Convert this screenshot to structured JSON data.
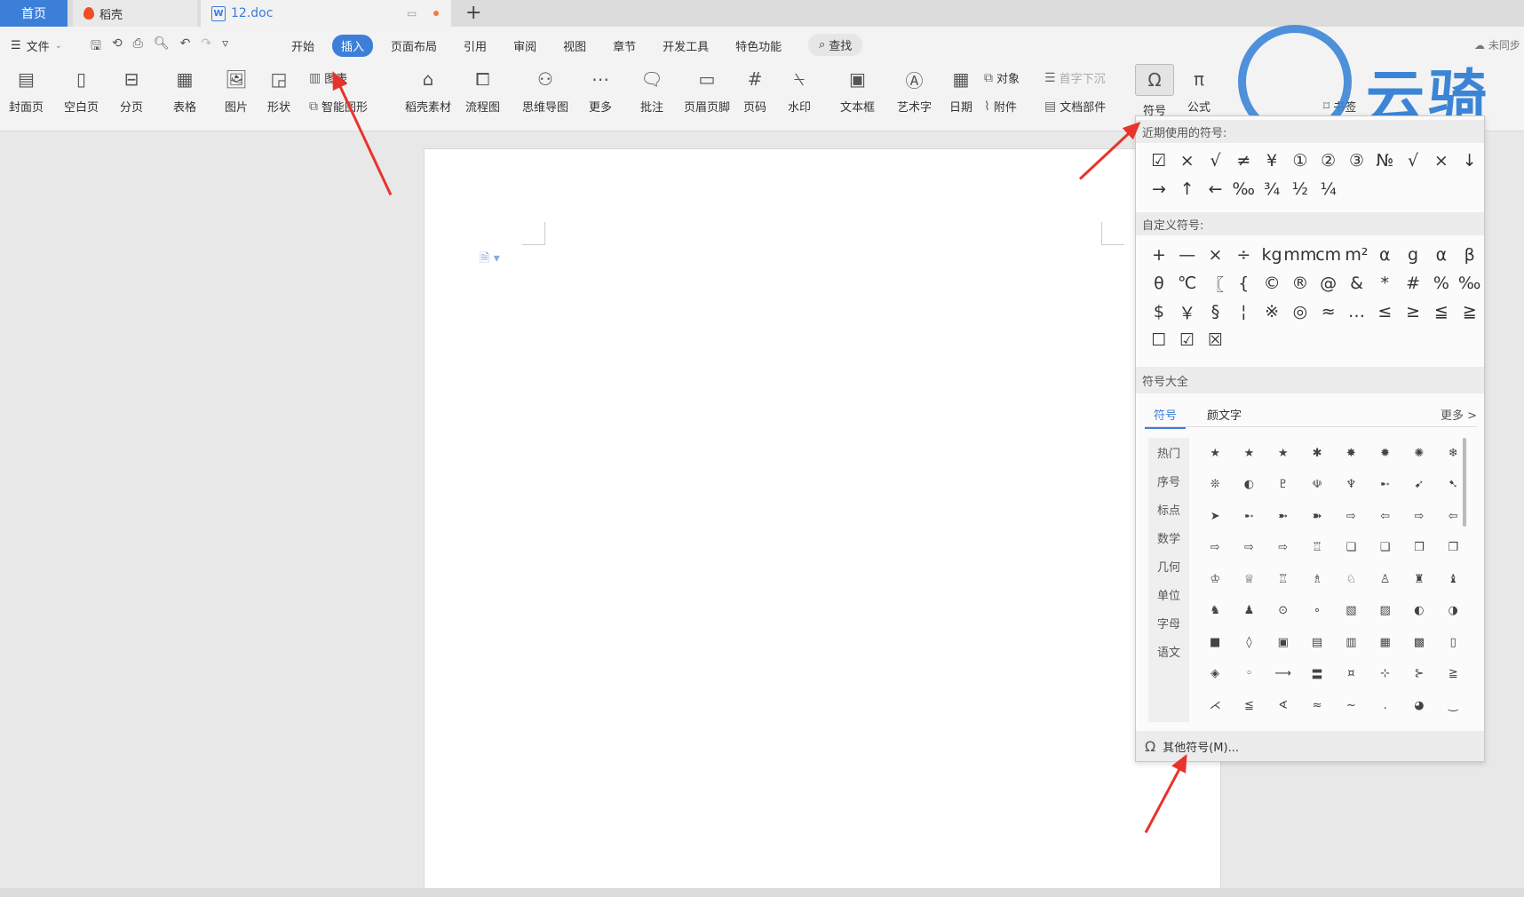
{
  "tabbar": {
    "home": "首页",
    "daoke": "稻壳",
    "doc": "12.doc",
    "plus": "+"
  },
  "menu": {
    "file": "文件",
    "items": [
      "开始",
      "插入",
      "页面布局",
      "引用",
      "审阅",
      "视图",
      "章节",
      "开发工具",
      "特色功能"
    ],
    "active": "插入",
    "search": "查找",
    "sync": "未同步"
  },
  "ribbon": {
    "buttons": [
      "封面页",
      "空白页",
      "分页",
      "表格",
      "图片",
      "形状",
      "稻壳素材",
      "流程图",
      "思维导图",
      "更多",
      "批注",
      "页眉页脚",
      "页码",
      "水印",
      "文本框",
      "艺术字",
      "日期",
      "符号",
      "公式"
    ],
    "small": {
      "chart": "图表",
      "smart_shape": "智能图形",
      "object": "对象",
      "drop_cap": "首字下沉",
      "attachment": "附件",
      "doc_parts": "文档部件",
      "bookmark": "书签"
    }
  },
  "logo": {
    "text": "云骑"
  },
  "symbol_panel": {
    "recent_header": "近期使用的符号:",
    "recent": [
      "☑",
      "×",
      "√",
      "≠",
      "¥",
      "①",
      "②",
      "③",
      "№",
      "√",
      "×",
      "↓",
      "→",
      "↑",
      "←",
      "‰",
      "¾",
      "½",
      "¼"
    ],
    "custom_header": "自定义符号:",
    "custom": [
      "+",
      "—",
      "×",
      "÷",
      "kg",
      "mm",
      "cm",
      "m²",
      "α",
      "g",
      "α",
      "β",
      "θ",
      "℃",
      "〖",
      "{",
      "©",
      "®",
      "@",
      "&",
      "*",
      "#",
      "%",
      "‰",
      "$",
      "￥",
      "§",
      "¦",
      "※",
      "◎",
      "≈",
      "…",
      "≤",
      "≥",
      "≦",
      "≧",
      "☐",
      "☑",
      "☒"
    ],
    "all_header": "符号大全",
    "tab_symbols": "符号",
    "tab_kaomoji": "颜文字",
    "more": "更多 >",
    "categories": [
      "热门",
      "序号",
      "标点",
      "数学",
      "几何",
      "单位",
      "字母",
      "语文"
    ],
    "grid": [
      "★",
      "★",
      "★",
      "✱",
      "✸",
      "✹",
      "✺",
      "❄",
      "❊",
      "◐",
      "♇",
      "☫",
      "♆",
      "➸",
      "➹",
      "➷",
      "➤",
      "➸",
      "➼",
      "➽",
      "⇨",
      "⇦",
      "⇨",
      "⇦",
      "⇨",
      "⇨",
      "⇨",
      "♖",
      "❏",
      "❑",
      "❒",
      "❐",
      "♔",
      "♕",
      "♖",
      "♗",
      "♘",
      "♙",
      "♜",
      "♝",
      "♞",
      "♟",
      "⊙",
      "∘",
      "▧",
      "▨",
      "◐",
      "◑",
      "■",
      "◊",
      "▣",
      "▤",
      "▥",
      "▦",
      "▩",
      "▯",
      "◈",
      "◦",
      "⟶",
      "〓",
      "¤",
      "⊹",
      "⊱",
      "≧",
      "⋌",
      "≦",
      "∢",
      "≈",
      "~",
      ".",
      "◕",
      "‿"
    ],
    "other": "其他符号(M)..."
  }
}
